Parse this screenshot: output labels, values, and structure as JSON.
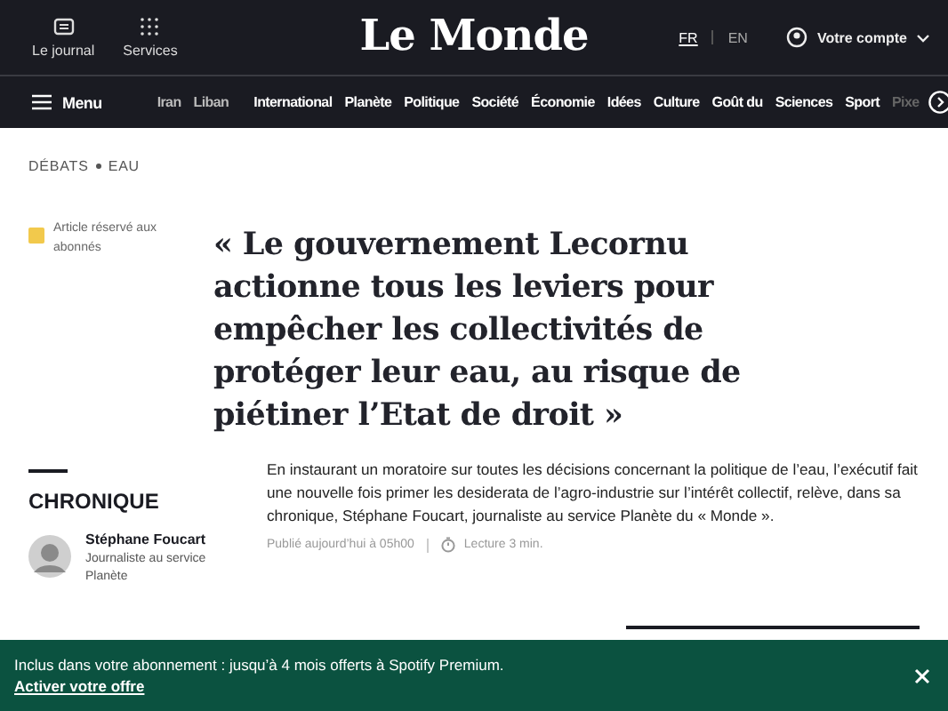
{
  "header": {
    "tools": [
      {
        "kind": "journal",
        "label": "Le journal"
      },
      {
        "kind": "services",
        "label": "Services"
      }
    ],
    "logo": "Le Monde",
    "languages": [
      {
        "label": "FR",
        "selected": true
      },
      {
        "label": "EN",
        "selected": false
      }
    ],
    "account": "Votre compte"
  },
  "nav": {
    "menu": "Menu",
    "hot": [
      "Iran",
      "Liban"
    ],
    "sections": [
      {
        "label": "International",
        "faded": false
      },
      {
        "label": "Planète",
        "faded": false
      },
      {
        "label": "Politique",
        "faded": false
      },
      {
        "label": "Société",
        "faded": false
      },
      {
        "label": "Économie",
        "faded": false
      },
      {
        "label": "Idées",
        "faded": false
      },
      {
        "label": "Culture",
        "faded": false
      },
      {
        "label": "Goût du",
        "faded": false
      },
      {
        "label": "Sciences",
        "faded": false
      },
      {
        "label": "Sport",
        "faded": false
      },
      {
        "label": "Pixe",
        "faded": true
      }
    ]
  },
  "breadcrumb": [
    "DÉBATS",
    "EAU"
  ],
  "subscriber_note": "Article réservé aux abonnés",
  "title": "« Le gouvernement Lecornu actionne tous les leviers pour empêcher les collectivités de protéger leur eau, au risque de piétiner l’Etat de droit »",
  "rubric": "CHRONIQUE",
  "author": {
    "name": "Stéphane Foucart",
    "role": "Journaliste au service Planète"
  },
  "summary": "En instaurant un moratoire sur toutes les décisions concernant la politique de l’eau, l’exécutif fait une nouvelle fois primer les desiderata de l’agro-industrie sur l’intérêt collectif, relève, dans sa chronique, Stéphane Foucart, journaliste au service Planète du « Monde ».",
  "meta": {
    "published": "Publié aujourd’hui à 05h00",
    "reading": "Lecture 3 min."
  },
  "banner": {
    "text": "Inclus dans votre abonnement : jusqu’à 4 mois offerts à Spotify Premium.",
    "link": "Activer votre offre"
  }
}
